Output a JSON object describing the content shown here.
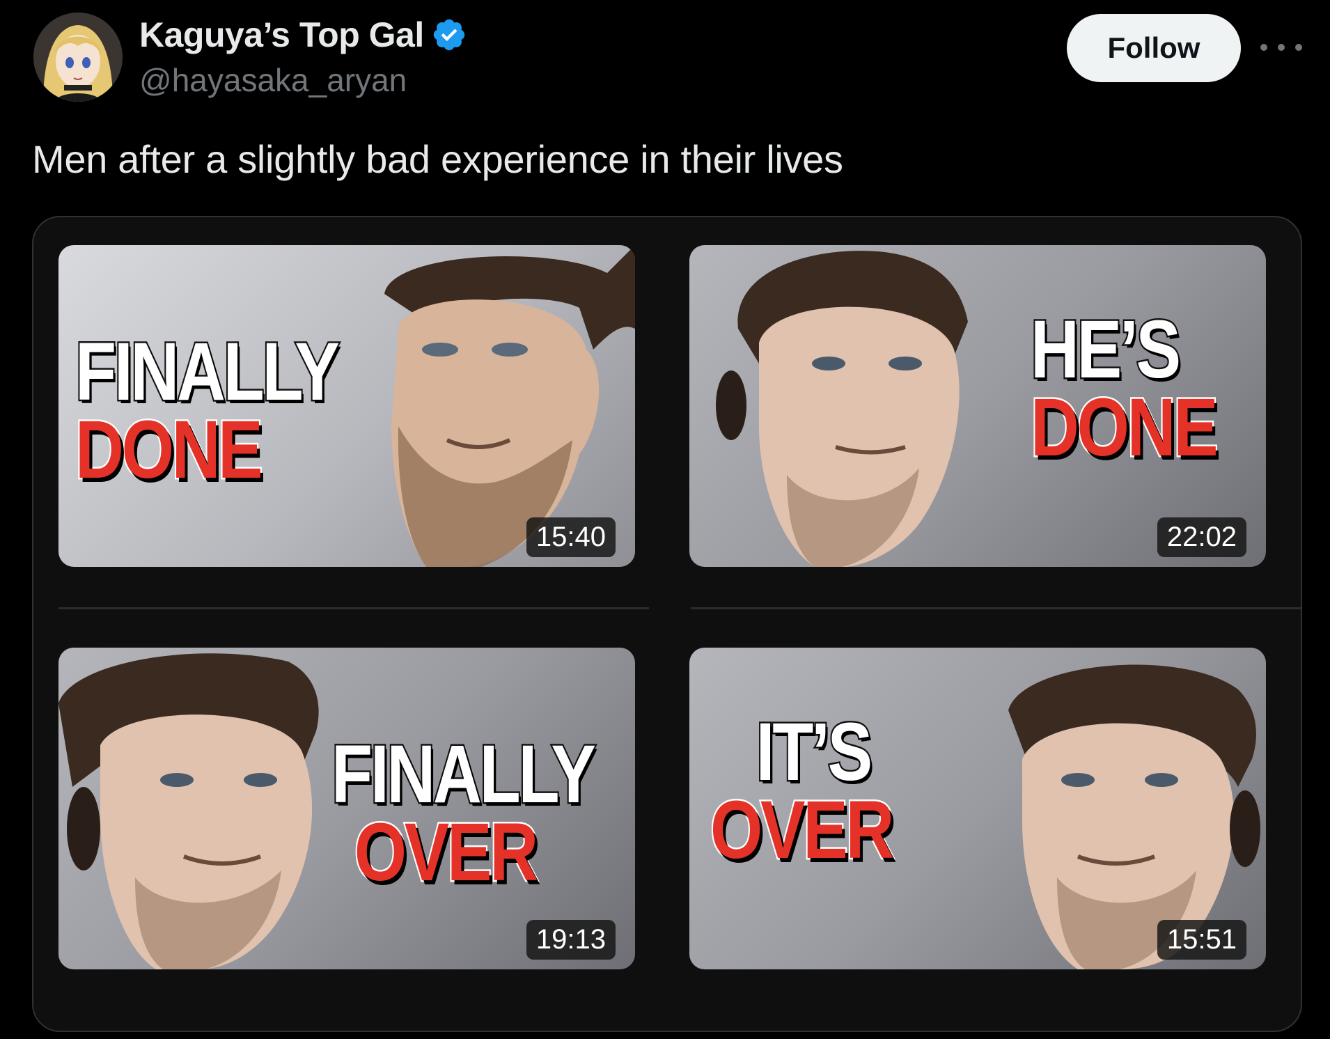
{
  "author": {
    "display_name": "Kaguya’s Top Gal",
    "handle": "@hayasaka_aryan",
    "verified": true,
    "avatar_icon": "anime-avatar-icon"
  },
  "actions": {
    "follow_label": "Follow",
    "more_icon": "more-options-icon"
  },
  "tweet": {
    "text": "Men after a slightly bad experience in their lives"
  },
  "media": {
    "thumbnails": [
      {
        "line1": "FINALLY",
        "line2": "DONE",
        "duration": "15:40"
      },
      {
        "line1": "HE’S",
        "line2": "DONE",
        "duration": "22:02"
      },
      {
        "line1": "FINALLY",
        "line2": "OVER",
        "duration": "19:13"
      },
      {
        "line1": "IT’S",
        "line2": "OVER",
        "duration": "15:51"
      }
    ]
  },
  "colors": {
    "background": "#000000",
    "text_primary": "#e7e9ea",
    "text_secondary": "#71767b",
    "verified_blue": "#1d9bf0",
    "follow_bg": "#eff3f4",
    "title_red": "#e53228"
  }
}
